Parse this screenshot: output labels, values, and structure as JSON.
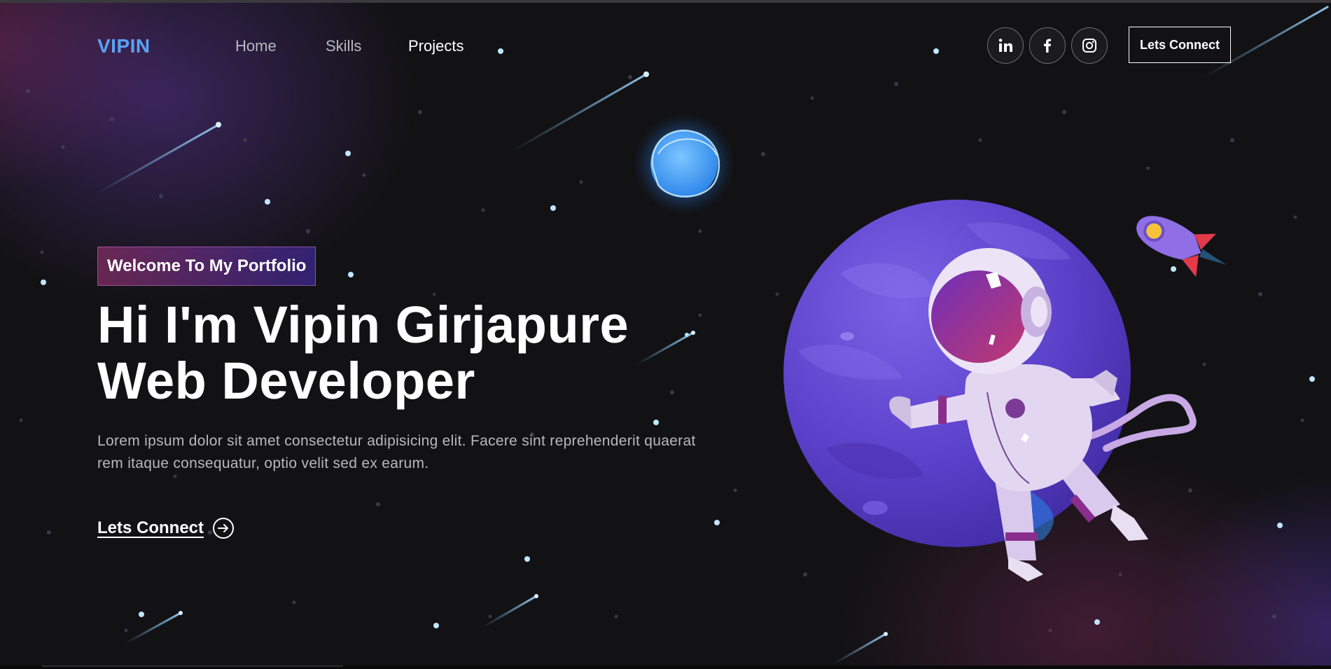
{
  "nav": {
    "logo": "VIPIN",
    "links": [
      {
        "label": "Home",
        "active": false
      },
      {
        "label": "Skills",
        "active": false
      },
      {
        "label": "Projects",
        "active": true
      }
    ],
    "social": [
      {
        "name": "linkedin-icon"
      },
      {
        "name": "facebook-icon"
      },
      {
        "name": "instagram-icon"
      }
    ],
    "cta_label": "Lets Connect"
  },
  "hero": {
    "tagline": "Welcome To My Portfolio",
    "title_line1": "Hi I'm Vipin Girjapure",
    "title_line2": "Web Developer",
    "description": "Lorem ipsum dolor sit amet consectetur adipisicing elit. Facere sint reprehenderit quaerat rem itaque consequatur, optio velit sed ex earum.",
    "cta_label": "Lets Connect",
    "cta_icon": "arrow-circle-right-icon"
  },
  "colors": {
    "background": "#121214",
    "logo": "#5aa2f5",
    "tagline_gradient_start": "#aa367c",
    "tagline_gradient_end": "#4a2fbd",
    "text_primary": "#ffffff",
    "text_muted": "#b8b8be"
  }
}
